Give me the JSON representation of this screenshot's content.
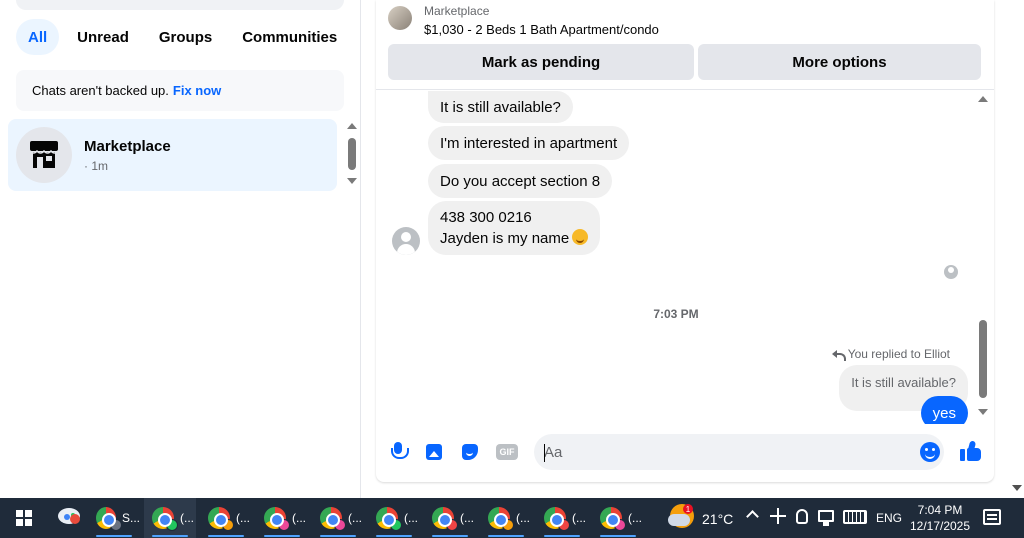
{
  "filters": {
    "all": "All",
    "unread": "Unread",
    "groups": "Groups",
    "communities": "Communities"
  },
  "backup_notice": {
    "text": "Chats aren't backed up.",
    "link": "Fix now"
  },
  "chat_list": [
    {
      "name": "Marketplace",
      "time": "· 1m",
      "icon": "storefront-icon"
    }
  ],
  "listing": {
    "source": "Marketplace",
    "title": "$1,030 - 2 Beds 1 Bath Apartment/condo"
  },
  "actions": {
    "pending": "Mark as pending",
    "more": "More options"
  },
  "messages": {
    "incoming": [
      "It is still available?",
      "I'm interested in apartment",
      "Do you accept section 8"
    ],
    "last_incoming_line1": "438 300 0216",
    "last_incoming_line2": "Jayden is my name",
    "timestamp": "7:03 PM",
    "replied_to": "You replied to Elliot",
    "quoted": "It is still available?",
    "outgoing": "yes"
  },
  "composer": {
    "placeholder": "Aa",
    "gif_label": "GIF"
  },
  "taskbar": {
    "apps": [
      {
        "label": "S...",
        "profile_color": "#6b7280"
      },
      {
        "label": "(...",
        "profile_color": "#22c55e"
      },
      {
        "label": "(...",
        "profile_color": "#f59e0b"
      },
      {
        "label": "(...",
        "profile_color": "#ec4899"
      },
      {
        "label": "(...",
        "profile_color": "#ec4899"
      },
      {
        "label": "(...",
        "profile_color": "#22c55e"
      },
      {
        "label": "(...",
        "profile_color": "#ef4444"
      },
      {
        "label": "(...",
        "profile_color": "#f59e0b"
      },
      {
        "label": "(...",
        "profile_color": "#ef4444"
      },
      {
        "label": "(...",
        "profile_color": "#ec4899"
      }
    ],
    "weather_badge": "1",
    "temperature": "21°C",
    "language": "ENG",
    "time": "7:04 PM",
    "date": "12/17/2025"
  },
  "colors": {
    "accent": "#0866ff",
    "selected_bg": "#ebf5ff",
    "taskbar_bg": "#1f2b3a"
  }
}
